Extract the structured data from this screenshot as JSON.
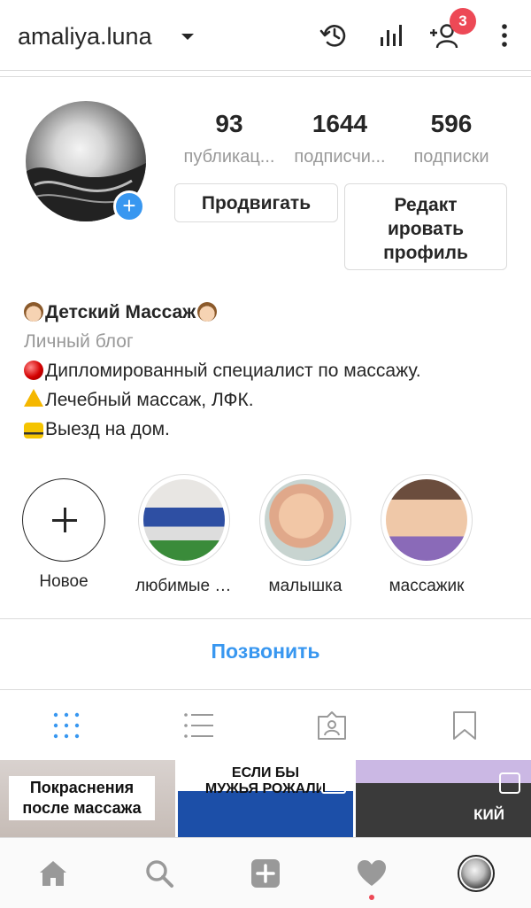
{
  "header": {
    "username": "amaliya.luna",
    "notifications_badge": "3",
    "icons": [
      "history-icon",
      "insights-icon",
      "add-person-icon",
      "more-vertical-icon"
    ]
  },
  "profile": {
    "stats": [
      {
        "value": "93",
        "label": "публикац..."
      },
      {
        "value": "1644",
        "label": "подписчи..."
      },
      {
        "value": "596",
        "label": "подписки"
      }
    ],
    "promote_label": "Продвигать",
    "edit_label_lines": [
      "Редакт",
      "ировать",
      "профиль"
    ]
  },
  "bio": {
    "name": "Детский Массаж",
    "category": "Личный блог",
    "lines": [
      "Дипломированный специалист по массажу.",
      "Лечебный массаж, ЛФК.",
      "Выезд на дом."
    ]
  },
  "highlights": [
    {
      "label": "Новое"
    },
    {
      "label": "любимые д..."
    },
    {
      "label": "малышка"
    },
    {
      "label": "массажик"
    }
  ],
  "call_label": "Позвонить",
  "grid": {
    "post1_caption": [
      "Покраснения",
      "после массажа"
    ],
    "post2_caption": [
      "ЕСЛИ БЫ",
      "МУЖЬЯ РОЖАЛИ"
    ],
    "post3_caption": "КИЙ"
  },
  "colors": {
    "accent": "#3897f0",
    "badge": "#ed4956",
    "text": "#262626",
    "muted": "#999999",
    "border": "#dbdbdb"
  }
}
